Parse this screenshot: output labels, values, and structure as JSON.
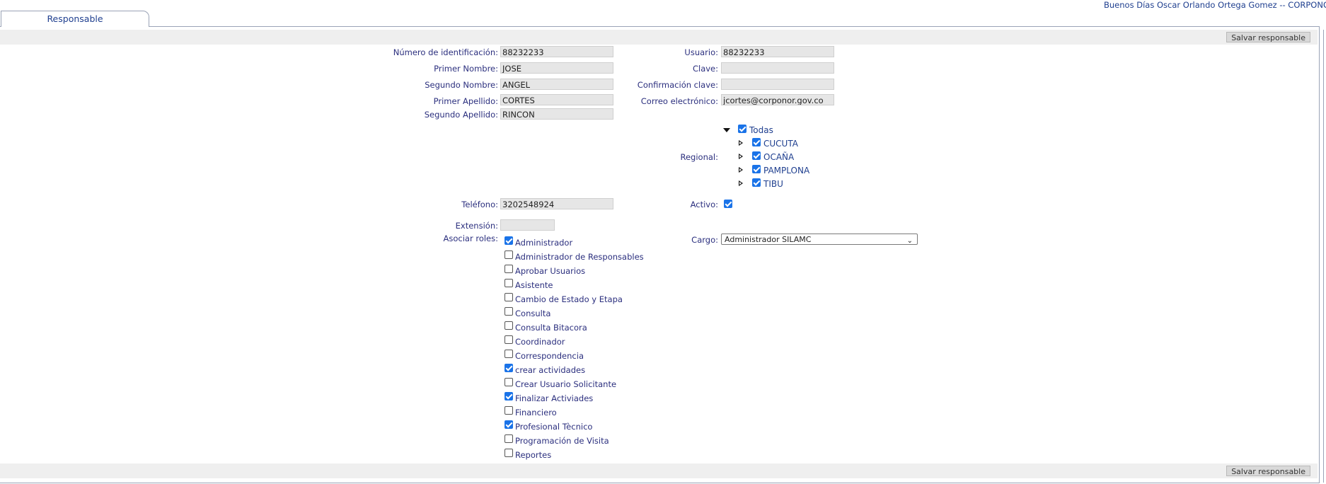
{
  "header": {
    "greeting": "Buenos Días Oscar Orlando Ortega Gomez -- CORPONOR"
  },
  "tab": {
    "label": "Responsable"
  },
  "toolbar": {
    "save_label": "Salvar responsable"
  },
  "form": {
    "identificacion": {
      "label": "Número de identificación:",
      "value": "88232233"
    },
    "primer_nombre": {
      "label": "Primer Nombre:",
      "value": "JOSE"
    },
    "segundo_nombre": {
      "label": "Segundo Nombre:",
      "value": "ANGEL"
    },
    "primer_apellido": {
      "label": "Primer Apellido:",
      "value": "CORTES"
    },
    "segundo_apellido": {
      "label": "Segundo Apellido:",
      "value": "RINCON"
    },
    "usuario": {
      "label": "Usuario:",
      "value": "88232233"
    },
    "clave": {
      "label": "Clave:",
      "value": ""
    },
    "confirmacion": {
      "label": "Confirmación clave:",
      "value": ""
    },
    "correo": {
      "label": "Correo electrónico:",
      "value": "jcortes@corponor.gov.co"
    },
    "regional": {
      "label": "Regional:",
      "root": {
        "label": "Todas",
        "checked": true,
        "expanded": true
      },
      "items": [
        {
          "label": "CUCUTA",
          "checked": true
        },
        {
          "label": "OCAÑA",
          "checked": true
        },
        {
          "label": "PAMPLONA",
          "checked": true
        },
        {
          "label": "TIBU",
          "checked": true
        }
      ]
    },
    "telefono": {
      "label": "Teléfono:",
      "value": "3202548924"
    },
    "activo": {
      "label": "Activo:",
      "checked": true
    },
    "extension": {
      "label": "Extensión:",
      "value": ""
    },
    "roles": {
      "label": "Asociar roles:",
      "items": [
        {
          "label": "Administrador",
          "checked": true
        },
        {
          "label": "Administrador de Responsables",
          "checked": false
        },
        {
          "label": "Aprobar Usuarios",
          "checked": false
        },
        {
          "label": "Asistente",
          "checked": false
        },
        {
          "label": "Cambio de Estado y Etapa",
          "checked": false
        },
        {
          "label": "Consulta",
          "checked": false
        },
        {
          "label": "Consulta Bitacora",
          "checked": false
        },
        {
          "label": "Coordinador",
          "checked": false
        },
        {
          "label": "Correspondencia",
          "checked": false
        },
        {
          "label": "crear actividades",
          "checked": true
        },
        {
          "label": "Crear Usuario Solicitante",
          "checked": false
        },
        {
          "label": "Finalizar Activiades",
          "checked": true
        },
        {
          "label": "Financiero",
          "checked": false
        },
        {
          "label": "Profesional Tècnico",
          "checked": true
        },
        {
          "label": "Programación de Visita",
          "checked": false
        },
        {
          "label": "Reportes",
          "checked": false
        }
      ]
    },
    "cargo": {
      "label": "Cargo:",
      "value": "Administrador SILAMC"
    }
  },
  "icons": {
    "checkbox_checked_color": "#1a73e8",
    "expanded": "triangle-down-icon",
    "collapsed": "triangle-right-icon"
  }
}
